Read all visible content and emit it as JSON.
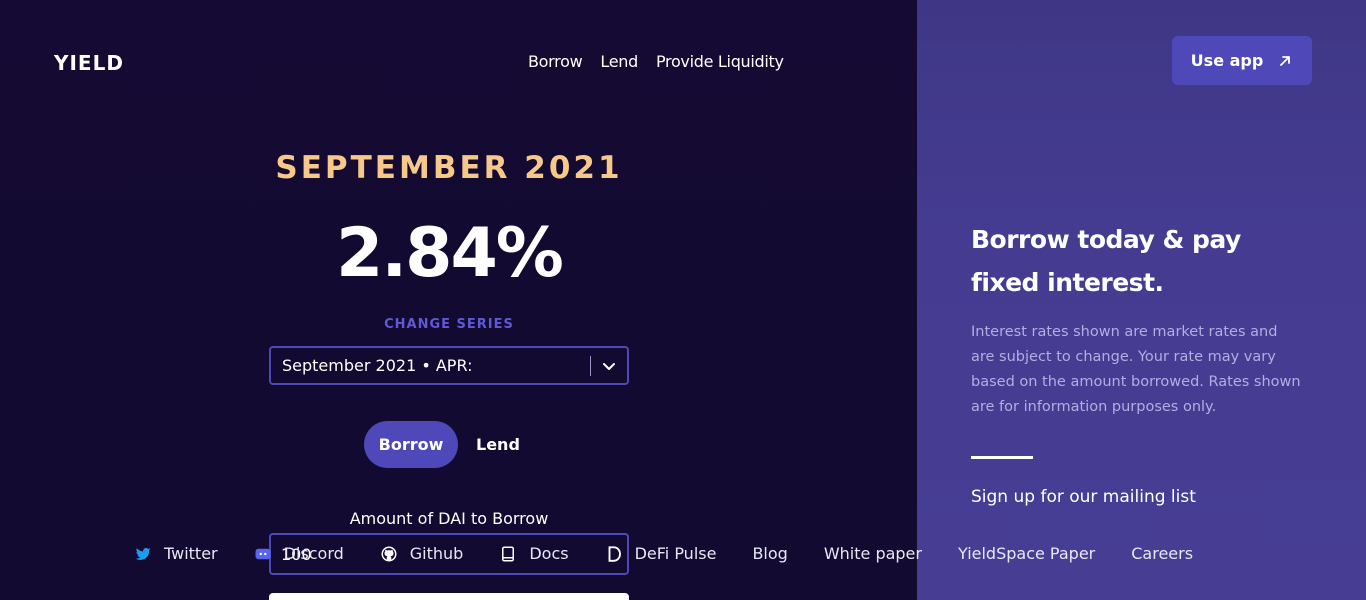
{
  "header": {
    "logo": "YIELD",
    "nav": [
      "Borrow",
      "Lend",
      "Provide Liquidity"
    ],
    "use_app_label": "Use app"
  },
  "main": {
    "series_title": "SEPTEMBER 2021",
    "rate": "2.84%",
    "change_series_label": "CHANGE SERIES",
    "series_select_value": "September 2021 • APR:",
    "tabs": {
      "borrow": "Borrow",
      "lend": "Lend",
      "active": "Borrow"
    },
    "amount_label": "Amount of DAI to Borrow",
    "amount_value": "100"
  },
  "footer": {
    "links": [
      {
        "label": "Twitter",
        "icon": "twitter-icon"
      },
      {
        "label": "Discord",
        "icon": "discord-icon"
      },
      {
        "label": "Github",
        "icon": "github-icon"
      },
      {
        "label": "Docs",
        "icon": "docs-icon"
      },
      {
        "label": "DeFi Pulse",
        "icon": "defi-pulse-icon"
      },
      {
        "label": "Blog"
      },
      {
        "label": "White paper"
      },
      {
        "label": "YieldSpace Paper"
      },
      {
        "label": "Careers"
      }
    ]
  },
  "side": {
    "headline": "Borrow today & pay fixed interest.",
    "disclaimer": "Interest rates shown are market rates and are subject to change. Your rate may vary based on the amount borrowed. Rates shown are for information purposes only.",
    "mailing_label": "Sign up for our mailing list"
  },
  "colors": {
    "background": "#120a30",
    "panel": "#453c92",
    "accent": "#4e48b8",
    "series_title": "#f6c98a",
    "change_label": "#5e5ad6"
  }
}
